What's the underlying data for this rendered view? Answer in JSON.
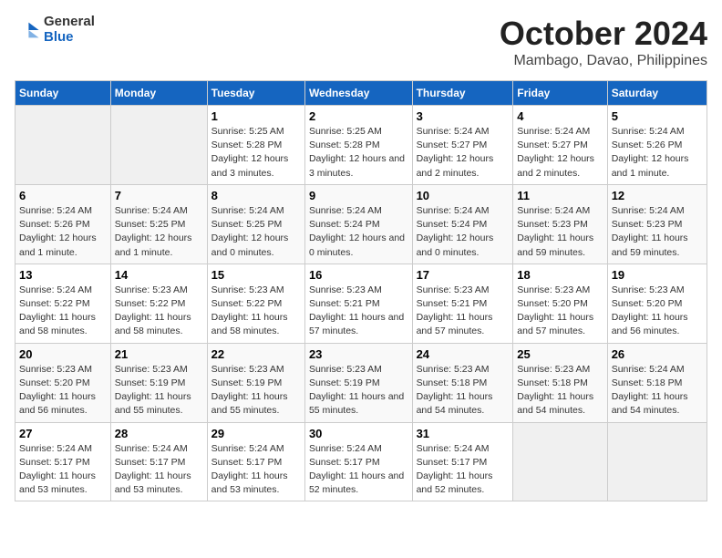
{
  "logo": {
    "general": "General",
    "blue": "Blue"
  },
  "title": "October 2024",
  "subtitle": "Mambago, Davao, Philippines",
  "headers": [
    "Sunday",
    "Monday",
    "Tuesday",
    "Wednesday",
    "Thursday",
    "Friday",
    "Saturday"
  ],
  "weeks": [
    [
      null,
      null,
      {
        "day": 1,
        "sunrise": "5:25 AM",
        "sunset": "5:28 PM",
        "daylight": "12 hours and 3 minutes."
      },
      {
        "day": 2,
        "sunrise": "5:25 AM",
        "sunset": "5:28 PM",
        "daylight": "12 hours and 3 minutes."
      },
      {
        "day": 3,
        "sunrise": "5:24 AM",
        "sunset": "5:27 PM",
        "daylight": "12 hours and 2 minutes."
      },
      {
        "day": 4,
        "sunrise": "5:24 AM",
        "sunset": "5:27 PM",
        "daylight": "12 hours and 2 minutes."
      },
      {
        "day": 5,
        "sunrise": "5:24 AM",
        "sunset": "5:26 PM",
        "daylight": "12 hours and 1 minute."
      }
    ],
    [
      {
        "day": 6,
        "sunrise": "5:24 AM",
        "sunset": "5:26 PM",
        "daylight": "12 hours and 1 minute."
      },
      {
        "day": 7,
        "sunrise": "5:24 AM",
        "sunset": "5:25 PM",
        "daylight": "12 hours and 1 minute."
      },
      {
        "day": 8,
        "sunrise": "5:24 AM",
        "sunset": "5:25 PM",
        "daylight": "12 hours and 0 minutes."
      },
      {
        "day": 9,
        "sunrise": "5:24 AM",
        "sunset": "5:24 PM",
        "daylight": "12 hours and 0 minutes."
      },
      {
        "day": 10,
        "sunrise": "5:24 AM",
        "sunset": "5:24 PM",
        "daylight": "12 hours and 0 minutes."
      },
      {
        "day": 11,
        "sunrise": "5:24 AM",
        "sunset": "5:23 PM",
        "daylight": "11 hours and 59 minutes."
      },
      {
        "day": 12,
        "sunrise": "5:24 AM",
        "sunset": "5:23 PM",
        "daylight": "11 hours and 59 minutes."
      }
    ],
    [
      {
        "day": 13,
        "sunrise": "5:24 AM",
        "sunset": "5:22 PM",
        "daylight": "11 hours and 58 minutes."
      },
      {
        "day": 14,
        "sunrise": "5:23 AM",
        "sunset": "5:22 PM",
        "daylight": "11 hours and 58 minutes."
      },
      {
        "day": 15,
        "sunrise": "5:23 AM",
        "sunset": "5:22 PM",
        "daylight": "11 hours and 58 minutes."
      },
      {
        "day": 16,
        "sunrise": "5:23 AM",
        "sunset": "5:21 PM",
        "daylight": "11 hours and 57 minutes."
      },
      {
        "day": 17,
        "sunrise": "5:23 AM",
        "sunset": "5:21 PM",
        "daylight": "11 hours and 57 minutes."
      },
      {
        "day": 18,
        "sunrise": "5:23 AM",
        "sunset": "5:20 PM",
        "daylight": "11 hours and 57 minutes."
      },
      {
        "day": 19,
        "sunrise": "5:23 AM",
        "sunset": "5:20 PM",
        "daylight": "11 hours and 56 minutes."
      }
    ],
    [
      {
        "day": 20,
        "sunrise": "5:23 AM",
        "sunset": "5:20 PM",
        "daylight": "11 hours and 56 minutes."
      },
      {
        "day": 21,
        "sunrise": "5:23 AM",
        "sunset": "5:19 PM",
        "daylight": "11 hours and 55 minutes."
      },
      {
        "day": 22,
        "sunrise": "5:23 AM",
        "sunset": "5:19 PM",
        "daylight": "11 hours and 55 minutes."
      },
      {
        "day": 23,
        "sunrise": "5:23 AM",
        "sunset": "5:19 PM",
        "daylight": "11 hours and 55 minutes."
      },
      {
        "day": 24,
        "sunrise": "5:23 AM",
        "sunset": "5:18 PM",
        "daylight": "11 hours and 54 minutes."
      },
      {
        "day": 25,
        "sunrise": "5:23 AM",
        "sunset": "5:18 PM",
        "daylight": "11 hours and 54 minutes."
      },
      {
        "day": 26,
        "sunrise": "5:24 AM",
        "sunset": "5:18 PM",
        "daylight": "11 hours and 54 minutes."
      }
    ],
    [
      {
        "day": 27,
        "sunrise": "5:24 AM",
        "sunset": "5:17 PM",
        "daylight": "11 hours and 53 minutes."
      },
      {
        "day": 28,
        "sunrise": "5:24 AM",
        "sunset": "5:17 PM",
        "daylight": "11 hours and 53 minutes."
      },
      {
        "day": 29,
        "sunrise": "5:24 AM",
        "sunset": "5:17 PM",
        "daylight": "11 hours and 53 minutes."
      },
      {
        "day": 30,
        "sunrise": "5:24 AM",
        "sunset": "5:17 PM",
        "daylight": "11 hours and 52 minutes."
      },
      {
        "day": 31,
        "sunrise": "5:24 AM",
        "sunset": "5:17 PM",
        "daylight": "11 hours and 52 minutes."
      },
      null,
      null
    ]
  ],
  "labels": {
    "sunrise": "Sunrise:",
    "sunset": "Sunset:",
    "daylight": "Daylight:"
  }
}
